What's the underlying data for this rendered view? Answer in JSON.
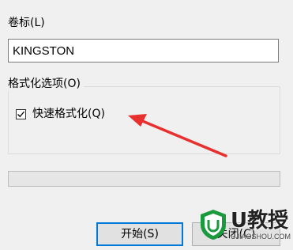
{
  "volume_label": {
    "label": "卷标(L)",
    "value": "KINGSTON"
  },
  "format_options": {
    "group_label": "格式化选项(O)",
    "quick_format": {
      "label": "快速格式化(Q)",
      "checked": true
    }
  },
  "progress": {
    "value": 0
  },
  "buttons": {
    "start": "开始(S)",
    "close": "关闭(C)"
  },
  "annotation": {
    "color": "#e8312f"
  },
  "watermark": {
    "brand": "U教授",
    "url": "UJIAOSHOU.COM"
  }
}
